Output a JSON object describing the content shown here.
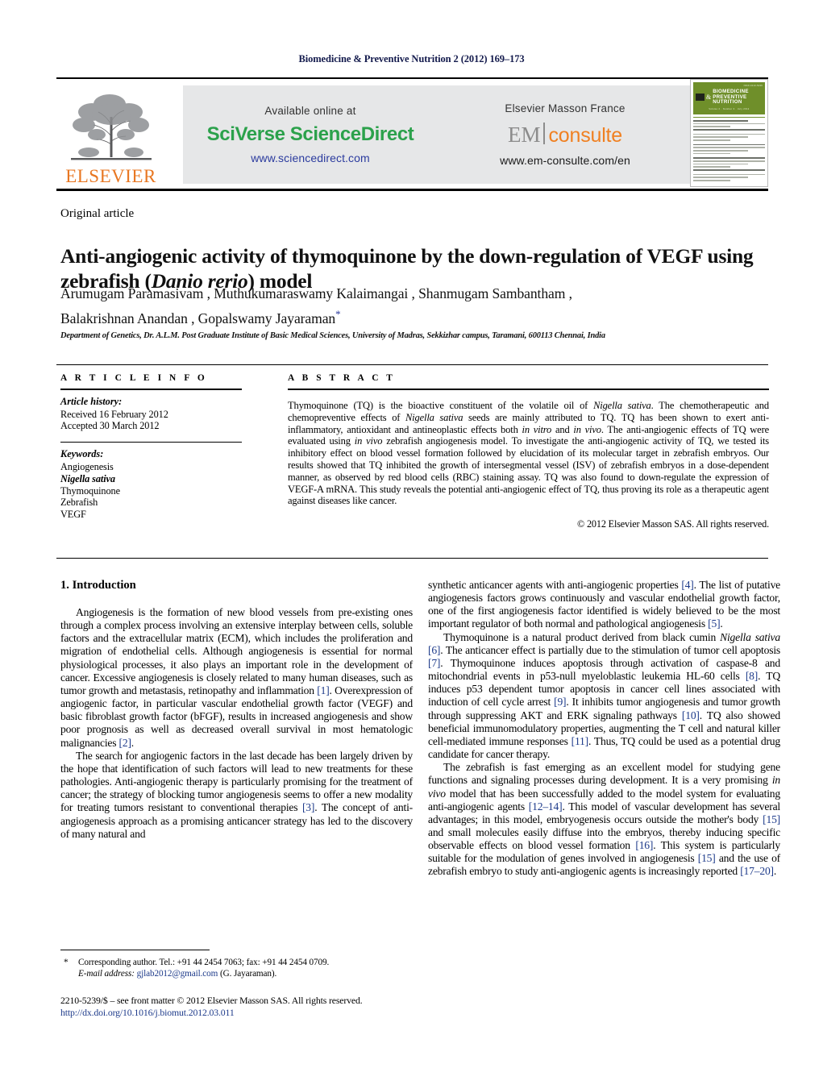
{
  "running_head": "Biomedicine & Preventive Nutrition 2 (2012) 169–173",
  "masthead": {
    "publisher_name": "ELSEVIER",
    "available_online_label": "Available online at",
    "sciverse_label": "SciVerse ScienceDirect",
    "sciencedirect_url": "www.sciencedirect.com",
    "masson_label": "Elsevier Masson France",
    "em_mark": "EM",
    "consulte_mark": "consulte",
    "emconsulte_url": "www.em-consulte.com/en",
    "cover": {
      "top_caption": "ISSN 2210-5239",
      "amp": "&",
      "title_line1": "BIOMEDICINE",
      "title_line2": "PREVENTIVE NUTRITION",
      "subtitle": "Volume 2 · Number 3 · July 2012"
    },
    "colors": {
      "sciverse_green": "#2ba14b",
      "url_blue": "#2b3b9e",
      "consulte_orange": "#f08021",
      "em_gray": "#8c8c8c",
      "elsevier_orange": "#e87722",
      "banner_gray": "#e6e7e8",
      "cover_green": "#6f8f2a",
      "running_head_navy": "#141b4d",
      "citation_blue": "#1d3a8a"
    }
  },
  "article": {
    "kicker": "Original article",
    "title_part1": "Anti-angiogenic activity of thymoquinone by the down-regulation of VEGF using zebrafish (",
    "title_italic": "Danio rerio",
    "title_part2": ") model",
    "authors_line1": "Arumugam Paramasivam , Muthukumaraswamy Kalaimangai , Shanmugam Sambantham ,",
    "authors_line2": "Balakrishnan Anandan , Gopalswamy Jayaraman",
    "corresponding_marker": "*",
    "affiliation": "Department of Genetics, Dr. A.L.M. Post Graduate Institute of Basic Medical Sciences, University of Madras, Sekkizhar campus, Taramani, 600113 Chennai, India"
  },
  "info": {
    "heading": "A R T I C L E    I N F O",
    "history_label": "Article history:",
    "received": "Received 16 February 2012",
    "accepted": "Accepted 30 March 2012",
    "keywords_label": "Keywords:",
    "keywords": [
      "Angiogenesis",
      "Nigella sativa",
      "Thymoquinone",
      "Zebrafish",
      "VEGF"
    ],
    "keywords_italic_index": 1
  },
  "abstract": {
    "heading": "A B S T R A C T",
    "p1a": "Thymoquinone (TQ) is the bioactive constituent of the volatile oil of ",
    "p1_it1": "Nigella sativa",
    "p1b": ". The chemotherapeutic and chemopreventive effects of ",
    "p1_it2": "Nigella sativa",
    "p1c": " seeds are mainly attributed to TQ. TQ has been shown to exert anti-inflammatory, antioxidant and antineoplastic effects both ",
    "p1_it3": "in vitro",
    "p1d": " and ",
    "p1_it4": "in vivo",
    "p1e": ". The anti-angiogenic effects of TQ were evaluated using ",
    "p1_it5": "in vivo",
    "p1f": " zebrafish angiogenesis model. To investigate the anti-angiogenic activity of TQ, we tested its inhibitory effect on blood vessel formation followed by elucidation of its molecular target in zebrafish embryos. Our results showed that TQ inhibited the growth of intersegmental vessel (ISV) of zebrafish embryos in a dose-dependent manner, as observed by red blood cells (RBC) staining assay. TQ was also found to down-regulate the expression of VEGF-A mRNA. This study reveals the potential anti-angiogenic effect of TQ, thus proving its role as a therapeutic agent against diseases like cancer.",
    "copyright": "© 2012 Elsevier Masson SAS. All rights reserved."
  },
  "body": {
    "section_number_title": "1. Introduction",
    "left_p1a": "Angiogenesis is the formation of new blood vessels from pre-existing ones through a complex process involving an extensive interplay between cells, soluble factors and the extracellular matrix (ECM), which includes the proliferation and migration of endothelial cells. Although angiogenesis is essential for normal physiological processes, it also plays an important role in the development of cancer. Excessive angiogenesis is closely related to many human diseases, such as tumor growth and metastasis, retinopathy and inflammation ",
    "left_p1_r1": "[1]",
    "left_p1b": ". Overexpression of angiogenic factor, in particular vascular endothelial growth factor (VEGF) and basic fibroblast growth factor (bFGF), results in increased angiogenesis and show poor prognosis as well as decreased overall survival in most hematologic malignancies ",
    "left_p1_r2": "[2]",
    "left_p1c": ".",
    "left_p2a": "The search for angiogenic factors in the last decade has been largely driven by the hope that identification of such factors will lead to new treatments for these pathologies. Anti-angiogenic therapy is particularly promising for the treatment of cancer; the strategy of blocking tumor angiogenesis seems to offer a new modality for treating tumors resistant to conventional therapies ",
    "left_p2_r1": "[3]",
    "left_p2b": ". The concept of anti-angiogenesis approach as a promising anticancer strategy has led to the discovery of many natural and",
    "right_p1a": "synthetic anticancer agents with anti-angiogenic properties ",
    "right_p1_r1": "[4]",
    "right_p1b": ". The list of putative angiogenesis factors grows continuously and vascular endothelial growth factor, one of the first angiogenesis factor identified is widely believed to be the most important regulator of both normal and pathological angiogenesis ",
    "right_p1_r2": "[5]",
    "right_p1c": ".",
    "right_p2a": "Thymoquinone is a natural product derived from black cumin ",
    "right_p2_it": "Nigella sativa",
    "right_p2b": " ",
    "right_p2_r1": "[6]",
    "right_p2c": ". The anticancer effect is partially due to the stimulation of tumor cell apoptosis ",
    "right_p2_r2": "[7]",
    "right_p2d": ". Thymoquinone induces apoptosis through activation of caspase-8 and mitochondrial events in p53-null myeloblastic leukemia HL-60 cells ",
    "right_p2_r3": "[8]",
    "right_p2e": ". TQ induces p53 dependent tumor apoptosis in cancer cell lines associated with induction of cell cycle arrest ",
    "right_p2_r4": "[9]",
    "right_p2f": ". It inhibits tumor angiogenesis and tumor growth through suppressing AKT and ERK signaling pathways ",
    "right_p2_r5": "[10]",
    "right_p2g": ". TQ also showed beneficial immunomodulatory properties, augmenting the T cell and natural killer cell-mediated immune responses ",
    "right_p2_r6": "[11]",
    "right_p2h": ". Thus, TQ could be used as a potential drug candidate for cancer therapy.",
    "right_p3a": "The zebrafish is fast emerging as an excellent model for studying gene functions and signaling processes during development. It is a very promising ",
    "right_p3_it1": "in vivo",
    "right_p3b": " model that has been successfully added to the model system for evaluating anti-angiogenic agents ",
    "right_p3_r1": "[12–14]",
    "right_p3c": ". This model of vascular development has several advantages; in this model, embryogenesis occurs outside the mother's body ",
    "right_p3_r2": "[15]",
    "right_p3d": " and small molecules easily diffuse into the embryos, thereby inducing specific observable effects on blood vessel formation ",
    "right_p3_r3": "[16]",
    "right_p3e": ". This system is particularly suitable for the modulation of genes involved in angiogenesis ",
    "right_p3_r4": "[15]",
    "right_p3f": " and the use of zebrafish embryo to study anti-angiogenic agents is increasingly reported ",
    "right_p3_r5": "[17–20]",
    "right_p3g": "."
  },
  "footer": {
    "footnote_star": "*",
    "footnote_line1": "Corresponding author. Tel.: +91 44 2454 7063; fax: +91 44 2454 0709.",
    "email_label": "E-mail address:",
    "email": "gjlab2012@gmail.com",
    "email_attrib": "(G. Jayaraman).",
    "imprint": "2210-5239/$ – see front matter © 2012 Elsevier Masson SAS. All rights reserved.",
    "doi": "http://dx.doi.org/10.1016/j.biomut.2012.03.011"
  }
}
